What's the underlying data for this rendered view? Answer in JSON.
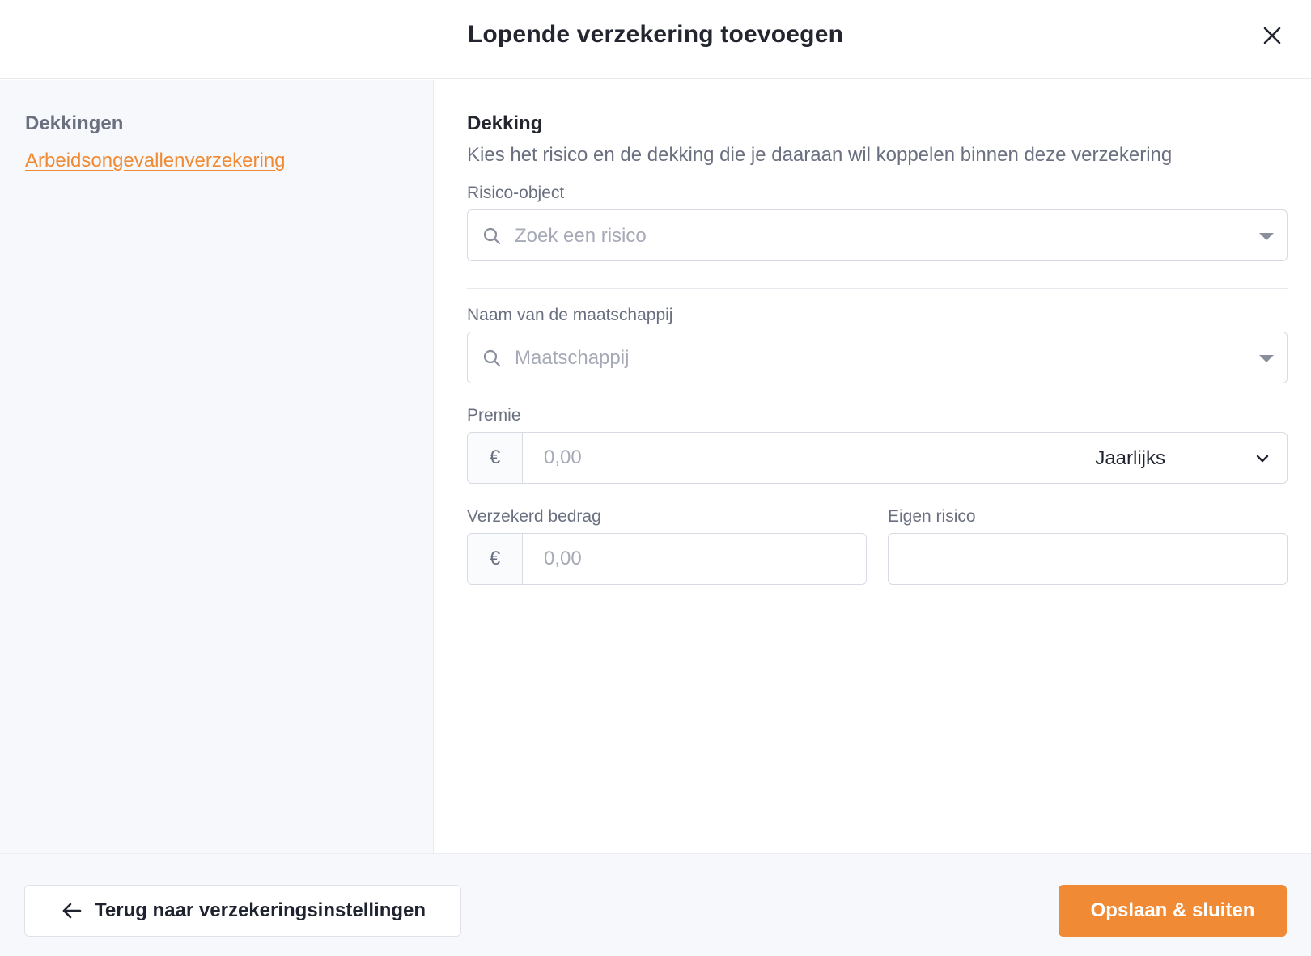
{
  "header": {
    "title": "Lopende verzekering toevoegen",
    "close_icon": "close-icon"
  },
  "sidebar": {
    "heading": "Dekkingen",
    "items": [
      {
        "label": "Arbeidsongevallenverzekering",
        "active": true
      }
    ]
  },
  "main": {
    "section_title": "Dekking",
    "section_subtitle": "Kies het risico en de dekking die je daaraan wil koppelen binnen deze verzekering",
    "risk_object": {
      "label": "Risico-object",
      "placeholder": "Zoek een risico"
    },
    "company": {
      "label": "Naam van de maatschappij",
      "placeholder": "Maatschappij"
    },
    "premium": {
      "label": "Premie",
      "currency": "€",
      "placeholder": "0,00",
      "frequency": "Jaarlijks"
    },
    "insured_amount": {
      "label": "Verzekerd bedrag",
      "currency": "€",
      "placeholder": "0,00"
    },
    "deductible": {
      "label": "Eigen risico",
      "value": ""
    }
  },
  "footer": {
    "back_label": "Terug naar verzekeringsinstellingen",
    "save_label": "Opslaan & sluiten"
  },
  "colors": {
    "accent": "#f08a34",
    "muted_text": "#6b7080",
    "border": "#d8dbe3",
    "panel_bg": "#f7f8fb"
  }
}
